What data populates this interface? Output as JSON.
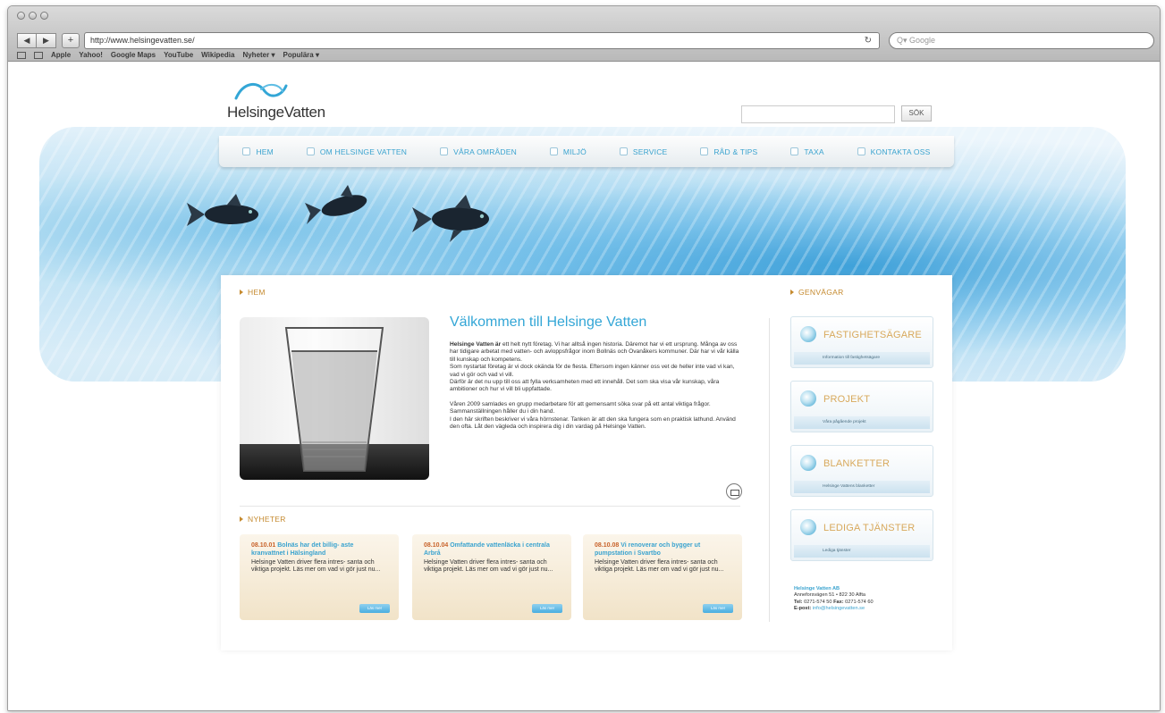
{
  "browser": {
    "url": "http://www.helsingevatten.se/",
    "search_placeholder": "Google",
    "bookmarks": [
      "Apple",
      "Yahoo!",
      "Google Maps",
      "YouTube",
      "Wikipedia",
      "Nyheter ▾",
      "Populära ▾"
    ]
  },
  "site": {
    "logo_text": "HelsingeVatten",
    "search_button": "SÖK",
    "nav": [
      "HEM",
      "OM HELSINGE VATTEN",
      "VÅRA OMRÅDEN",
      "MILJÖ",
      "SERVICE",
      "RÅD & TIPS",
      "TAXA",
      "KONTAKTA OSS"
    ]
  },
  "main": {
    "section_label": "HEM",
    "welcome_title": "Välkommen till Helsinge Vatten",
    "welcome_lead": "Helsinge Vatten är",
    "welcome_p1": "ett helt nytt företag. Vi har alltså ingen historia. Däremot har vi ett ursprung. Många av oss har tidigare arbetat med vatten- och avloppsfrågor inom Bollnäs och Ovanåkers kommuner. Där har vi vår källa till kunskap och kompetens.",
    "welcome_p2": "Som nystartat företag är vi dock okända för de flesta. Eftersom ingen känner oss vet de heller inte vad vi kan, vad vi gör och vad vi vill.",
    "welcome_p3": "Därför är det nu upp till oss att fylla verksamheten med ett innehåll. Det som ska visa vår kunskap, våra ambitioner och hur vi vill bli uppfattade.",
    "welcome_p4": "Våren 2009 samlades en grupp medarbetare för att gemensamt söka svar på ett antal viktiga frågor. Sammanställningen håller du i din hand.",
    "welcome_p5": "I den här skriften beskriver vi våra hörnstenar. Tanken är att den ska fungera som en praktisk lathund. Använd den ofta. Låt den vägleda och inspirera dig i din vardag på Helsinge Vatten."
  },
  "news": {
    "section_label": "NYHETER",
    "items": [
      {
        "date": "08.10.01",
        "title": "Bolnäs har det billig- aste kranvattnet i Hälsingland",
        "text": "Helsinge Vatten driver flera intres- santa och viktiga projekt. Läs mer om vad vi gör just nu...",
        "button": "Läs mer"
      },
      {
        "date": "08.10.04",
        "title": "Omfattande vattenläcka i centrala Arbrå",
        "text": "Helsinge Vatten driver flera intres- santa och viktiga projekt. Läs mer om vad vi gör just nu...",
        "button": "Läs mer"
      },
      {
        "date": "08.10.08",
        "title": "Vi renoverar och bygger ut pumpstation i Svartbo",
        "text": "Helsinge Vatten driver flera intres- santa och viktiga projekt. Läs mer om vad vi gör just nu...",
        "button": "Läs mer"
      }
    ]
  },
  "shortcuts": {
    "section_label": "GENVÄGAR",
    "items": [
      {
        "title": "FASTIGHETSÄGARE",
        "sub": "Information till fastighetsägare"
      },
      {
        "title": "PROJEKT",
        "sub": "Våra pågående projekt"
      },
      {
        "title": "BLANKETTER",
        "sub": "Helsinge Vattens blanketter"
      },
      {
        "title": "LEDIGA TJÄNSTER",
        "sub": "Lediga tjänster"
      }
    ]
  },
  "contact": {
    "company": "Helsinge Vatten AB",
    "street": "Anneforsvägen 51 • 822 30 Alfta",
    "phone_label": "Tel:",
    "phone": "0271-574 50",
    "fax_label": "Fax:",
    "fax": "0271-574 60",
    "email_label": "E-post:",
    "email": "info@helsingevatten.se"
  },
  "colors": {
    "accent": "#33a6d6",
    "label_gold": "#c58a2f",
    "news_date": "#c8622a"
  }
}
